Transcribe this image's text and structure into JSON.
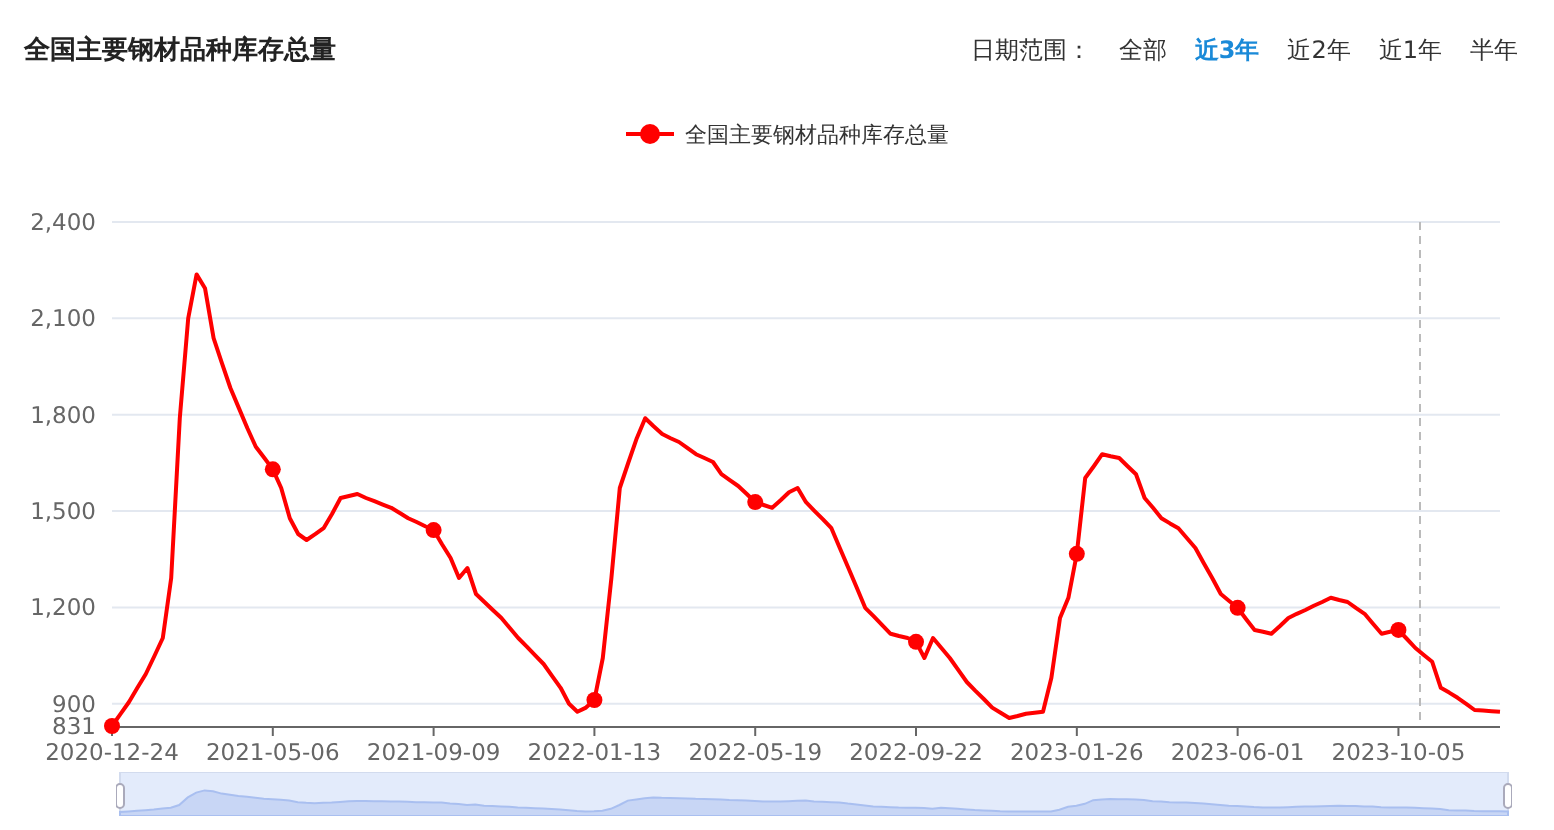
{
  "title": "全国主要钢材品种库存总量",
  "date_range": {
    "label": "日期范围：",
    "options": [
      {
        "label": "全部",
        "selected": false
      },
      {
        "label": "近3年",
        "selected": true
      },
      {
        "label": "近2年",
        "selected": false
      },
      {
        "label": "近1年",
        "selected": false
      },
      {
        "label": "半年",
        "selected": false
      }
    ]
  },
  "chart": {
    "chart_data": {
      "type": "line",
      "grid": true,
      "categories": [
        "2020-12-24",
        null,
        null,
        null,
        null,
        null,
        null,
        null,
        null,
        null,
        null,
        null,
        null,
        null,
        null,
        null,
        null,
        null,
        null,
        "2021-05-06",
        null,
        null,
        null,
        null,
        null,
        null,
        null,
        null,
        null,
        null,
        null,
        null,
        null,
        null,
        null,
        null,
        null,
        null,
        "2021-09-09",
        null,
        null,
        null,
        null,
        null,
        null,
        null,
        null,
        null,
        null,
        null,
        null,
        null,
        null,
        null,
        null,
        null,
        null,
        "2022-01-13",
        null,
        null,
        null,
        null,
        null,
        null,
        null,
        null,
        null,
        null,
        null,
        null,
        null,
        null,
        null,
        null,
        null,
        null,
        "2022-05-19",
        null,
        null,
        null,
        null,
        null,
        null,
        null,
        null,
        null,
        null,
        null,
        null,
        null,
        null,
        null,
        null,
        null,
        null,
        "2022-09-22",
        null,
        null,
        null,
        null,
        null,
        null,
        null,
        null,
        null,
        null,
        null,
        null,
        null,
        null,
        null,
        null,
        null,
        null,
        "2023-01-26",
        null,
        null,
        null,
        null,
        null,
        null,
        null,
        null,
        null,
        null,
        null,
        null,
        null,
        null,
        null,
        null,
        null,
        null,
        "2023-06-01",
        null,
        null,
        null,
        null,
        null,
        null,
        null,
        null,
        null,
        null,
        null,
        null,
        null,
        null,
        null,
        null,
        null,
        null,
        "2023-10-05",
        null,
        null,
        null,
        null,
        null,
        null,
        null,
        null,
        null,
        null,
        null,
        null
      ],
      "series": [
        {
          "name": "全国主要钢材品种库存总量",
          "color": "#ff0000",
          "values": [
            831,
            868,
            906,
            950,
            993,
            1049,
            1105,
            1292,
            1789,
            2100,
            2237,
            2194,
            2038,
            1960,
            1883,
            1820,
            1758,
            1700,
            1665,
            1630,
            1572,
            1478,
            1429,
            1410,
            1428,
            1447,
            1491,
            1541,
            1547,
            1553,
            1541,
            1531,
            1520,
            1510,
            1494,
            1478,
            1466,
            1453,
            1441,
            1397,
            1354,
            1292,
            1323,
            1242,
            1217,
            1192,
            1167,
            1136,
            1105,
            1078,
            1051,
            1024,
            987,
            950,
            900,
            875,
            888,
            912,
            1043,
            1292,
            1572,
            1650,
            1727,
            1789,
            1764,
            1740,
            1727,
            1715,
            1696,
            1677,
            1665,
            1653,
            1615,
            1596,
            1578,
            1553,
            1528,
            1519,
            1510,
            1534,
            1559,
            1572,
            1528,
            1501,
            1474,
            1447,
            1385,
            1323,
            1261,
            1199,
            1172,
            1145,
            1118,
            1111,
            1105,
            1093,
            1043,
            1105,
            1074,
            1043,
            1005,
            968,
            941,
            915,
            888,
            872,
            856,
            862,
            869,
            872,
            875,
            981,
            1167,
            1230,
            1367,
            1603,
            1640,
            1677,
            1671,
            1665,
            1640,
            1615,
            1541,
            1510,
            1478,
            1462,
            1447,
            1416,
            1385,
            1338,
            1292,
            1242,
            1220,
            1199,
            1164,
            1130,
            1124,
            1118,
            1142,
            1167,
            1180,
            1192,
            1205,
            1217,
            1230,
            1223,
            1217,
            1198,
            1180,
            1149,
            1118,
            1124,
            1130,
            1102,
            1074,
            1052,
            1031,
            950,
            935,
            919,
            900,
            881,
            879,
            877,
            875
          ]
        }
      ],
      "ylim": [
        831,
        2400
      ],
      "yticks": [
        {
          "value": 831,
          "label": "831"
        },
        {
          "value": 900,
          "label": "900"
        },
        {
          "value": 1200,
          "label": "1,200"
        },
        {
          "value": 1500,
          "label": "1,500"
        },
        {
          "value": 1800,
          "label": "1,800"
        },
        {
          "value": 2100,
          "label": "2,100"
        },
        {
          "value": 2400,
          "label": "2,400"
        }
      ]
    }
  },
  "range_slider": {
    "level": 1
  }
}
